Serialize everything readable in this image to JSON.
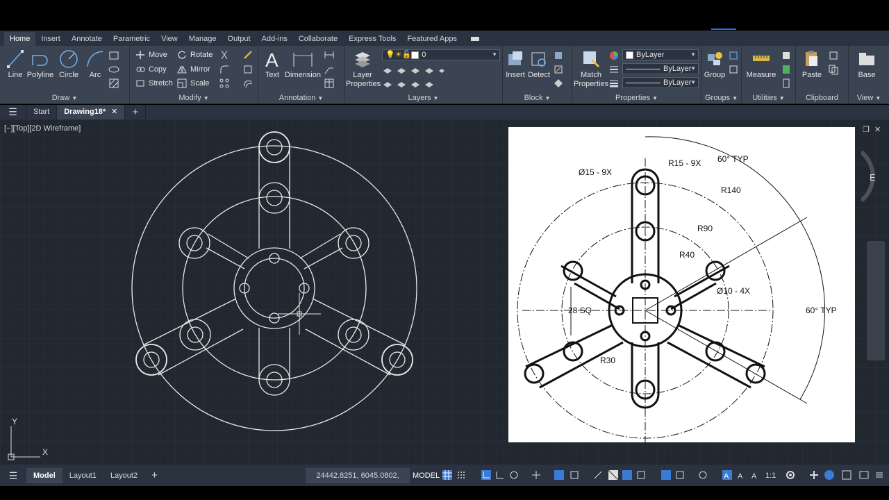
{
  "ribbon_tabs": [
    "Home",
    "Insert",
    "Annotate",
    "Parametric",
    "View",
    "Manage",
    "Output",
    "Add-ins",
    "Collaborate",
    "Express Tools",
    "Featured Apps"
  ],
  "panels": {
    "draw": {
      "title": "Draw",
      "line": "Line",
      "polyline": "Polyline",
      "circle": "Circle",
      "arc": "Arc"
    },
    "modify": {
      "title": "Modify",
      "move": "Move",
      "rotate": "Rotate",
      "copy": "Copy",
      "mirror": "Mirror",
      "stretch": "Stretch",
      "scale": "Scale"
    },
    "annotation": {
      "title": "Annotation",
      "text": "Text",
      "dimension": "Dimension"
    },
    "layers": {
      "title": "Layers",
      "layer_properties_1": "Layer",
      "layer_properties_2": "Properties",
      "current_layer": "0"
    },
    "block": {
      "title": "Block",
      "insert": "Insert",
      "detect": "Detect"
    },
    "properties": {
      "title": "Properties",
      "match_1": "Match",
      "match_2": "Properties",
      "color": "ByLayer",
      "linetype": "ByLayer",
      "lineweight": "ByLayer"
    },
    "groups": {
      "title": "Groups",
      "group": "Group"
    },
    "utilities": {
      "title": "Utilities",
      "measure": "Measure"
    },
    "clipboard": {
      "title": "Clipboard",
      "paste": "Paste"
    },
    "view": {
      "title": "View",
      "base": "Base"
    }
  },
  "file_tabs": {
    "start": "Start",
    "drawing": "Drawing18*"
  },
  "viewport": {
    "label": "[−][Top][2D Wireframe]"
  },
  "reference_drawing": {
    "dims": {
      "hole15": "Ø15 - 9X",
      "r15": "R15 - 9X",
      "angle_top": "60° TYP",
      "r140": "R140",
      "r90": "R90",
      "r40": "R40",
      "hole10": "Ø10 - 4X",
      "sq": "28 SQ",
      "angle_right": "60° TYP",
      "r30": "R30"
    }
  },
  "ucs": {
    "y": "Y",
    "x": "X"
  },
  "status": {
    "tabs": [
      "Model",
      "Layout1",
      "Layout2"
    ],
    "coords": "24442.8251, 6045.0802, 0.0000",
    "mode": "MODEL",
    "scale": "1:1"
  },
  "viewcube_letter": "E"
}
